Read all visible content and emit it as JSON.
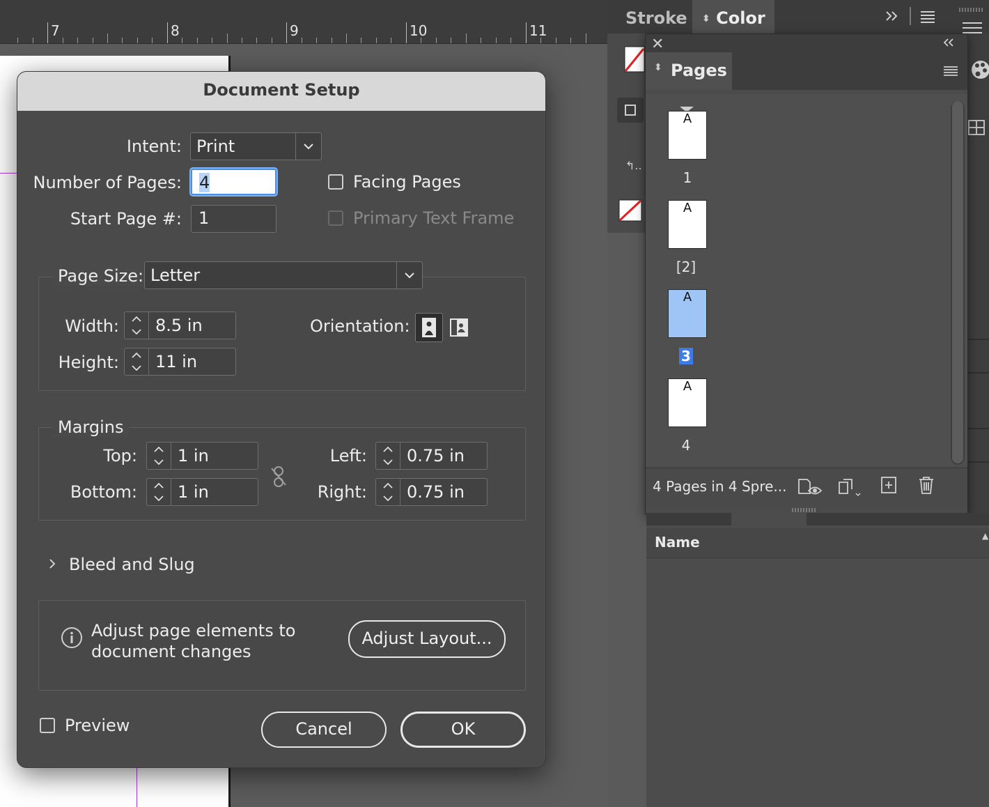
{
  "ruler": {
    "numbers": [
      "7",
      "8",
      "9",
      "10",
      "11"
    ]
  },
  "dialog": {
    "title": "Document Setup",
    "intent": {
      "label": "Intent:",
      "value": "Print"
    },
    "number_of_pages": {
      "label": "Number of Pages:",
      "value": "4"
    },
    "start_page": {
      "label": "Start Page #:",
      "value": "1"
    },
    "facing_pages": {
      "label": "Facing Pages",
      "checked": false
    },
    "primary_text_frame": {
      "label": "Primary Text Frame",
      "checked": false,
      "disabled": true
    },
    "page_size": {
      "label": "Page Size:",
      "value": "Letter"
    },
    "width": {
      "label": "Width:",
      "value": "8.5 in"
    },
    "height": {
      "label": "Height:",
      "value": "11 in"
    },
    "orientation": {
      "label": "Orientation:",
      "selected": "portrait"
    },
    "margins": {
      "label": "Margins",
      "top": {
        "label": "Top:",
        "value": "1 in"
      },
      "bottom": {
        "label": "Bottom:",
        "value": "1 in"
      },
      "left": {
        "label": "Left:",
        "value": "0.75 in"
      },
      "right": {
        "label": "Right:",
        "value": "0.75 in"
      }
    },
    "bleed_slug": {
      "label": "Bleed and Slug"
    },
    "adjust": {
      "line1": "Adjust page elements to",
      "line2": "document changes",
      "button": "Adjust Layout..."
    },
    "preview": {
      "label": "Preview",
      "checked": false
    },
    "cancel_button": "Cancel",
    "ok_button": "OK"
  },
  "panels": {
    "tabs": [
      "Stroke",
      "Color"
    ],
    "pages": {
      "title": "Pages",
      "items": [
        {
          "master": "A",
          "label": "1",
          "selected": false
        },
        {
          "master": "A",
          "label": "[2]",
          "selected": false
        },
        {
          "master": "A",
          "label": "3",
          "selected": true
        },
        {
          "master": "A",
          "label": "4",
          "selected": false
        }
      ],
      "status": "4 Pages in 4 Spre..."
    },
    "layers": {
      "column_header": "Name"
    }
  },
  "colors": {
    "selection_blue": "#3e7ce3",
    "focus_blue": "#4a8fe7",
    "guide_purple": "#b03bd4"
  }
}
